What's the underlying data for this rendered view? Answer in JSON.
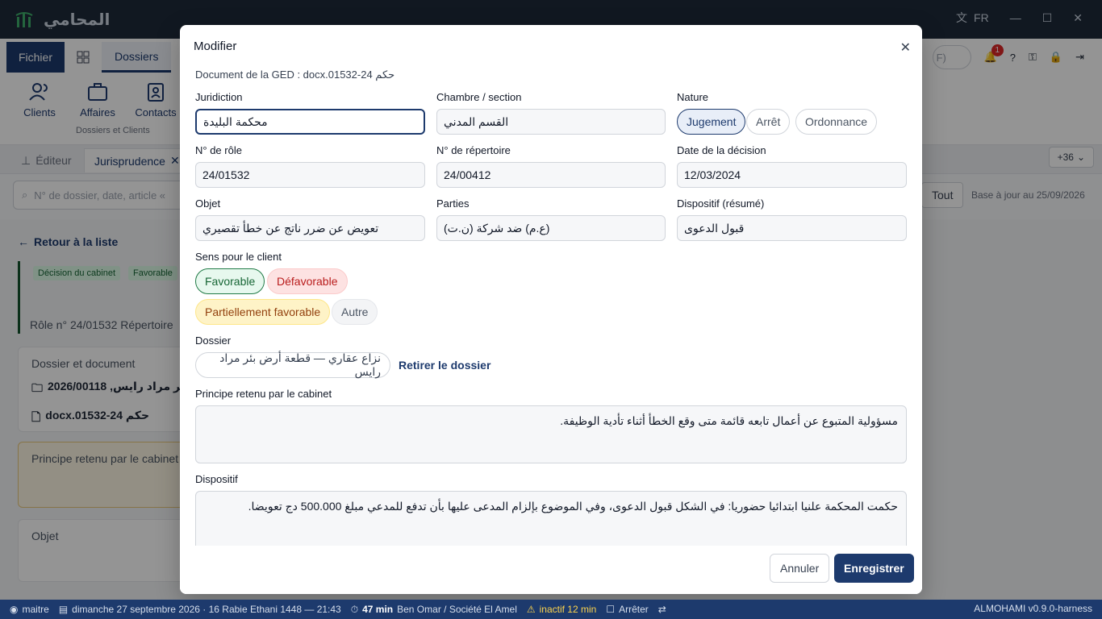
{
  "titlebar": {
    "app_name": "المحامي",
    "lang": "FR"
  },
  "ribbon": {
    "file_tab": "Fichier",
    "active_tab": "Dossiers",
    "items": [
      "Clients",
      "Affaires",
      "Contacts"
    ],
    "group_label": "Dossiers et Clients",
    "search_stub": "F)",
    "notif_count": "1"
  },
  "doctabs": {
    "editor": "Éditeur",
    "jurisprudence": "Jurisprudence",
    "more": "+36"
  },
  "searchrow": {
    "placeholder": "N° de dossier, date, article «",
    "tout": "Tout",
    "base": "Base à jour au 25/09/2026"
  },
  "left": {
    "back": "Retour à la liste",
    "tag1": "Décision du cabinet",
    "tag2": "Favorable",
    "meta": "Rôle n° 24/01532   Répertoire",
    "dossier_card_title": "Dossier et document",
    "dossier_line": "2026/00118 ,بئر مراد رايس",
    "doc_line": "docx.01532-24 حكم",
    "principe_title": "Principe retenu par le cabinet",
    "objet_title": "Objet"
  },
  "modal": {
    "title": "Modifier",
    "doc_ref": "Document de la GED : docx.01532-24 حكم",
    "juridiction": {
      "label": "Juridiction",
      "value": "محكمة البليدة"
    },
    "chambre": {
      "label": "Chambre / section",
      "value": "القسم المدني"
    },
    "nature": {
      "label": "Nature",
      "options": [
        "Jugement",
        "Arrêt",
        "Ordonnance"
      ]
    },
    "role": {
      "label": "N° de rôle",
      "value": "24/01532"
    },
    "repertoire": {
      "label": "N° de répertoire",
      "value": "24/00412"
    },
    "date": {
      "label": "Date de la décision",
      "value": "12/03/2024"
    },
    "objet": {
      "label": "Objet",
      "value": "تعويض عن ضرر ناتج عن خطأ تقصيري"
    },
    "parties": {
      "label": "Parties",
      "value": "(ع.م) ضد شركة (ن.ت)"
    },
    "dispositif_resume": {
      "label": "Dispositif (résumé)",
      "value": "قبول الدعوى"
    },
    "sens": {
      "label": "Sens pour le client",
      "options": [
        "Favorable",
        "Défavorable",
        "Partiellement favorable",
        "Autre"
      ]
    },
    "dossier": {
      "label": "Dossier",
      "value": "نزاع عقاري — قطعة أرض بئر مراد رايس",
      "remove": "Retirer le dossier"
    },
    "principe": {
      "label": "Principe retenu par le cabinet",
      "value": "مسؤولية المتبوع عن أعمال تابعه قائمة متى وقع الخطأ أثناء تأدية الوظيفة."
    },
    "dispositif": {
      "label": "Dispositif",
      "value": "حكمت المحكمة علنيا ابتدائيا حضوريا: في الشكل قبول الدعوى، وفي الموضوع بإلزام المدعى عليها بأن تدفع للمدعي مبلغ 500.000 دج تعويضا."
    },
    "cancel": "Annuler",
    "save": "Enregistrer"
  },
  "statusbar": {
    "user": "maitre",
    "date": "dimanche 27 septembre 2026 · 16 Rabie Ethani 1448 — 21:43",
    "timer": "47 min",
    "client": "Ben Omar / Société El Amel",
    "inactive": "inactif 12 min",
    "stop": "Arrêter",
    "version": "ALMOHAMI v0.9.0-harness"
  }
}
